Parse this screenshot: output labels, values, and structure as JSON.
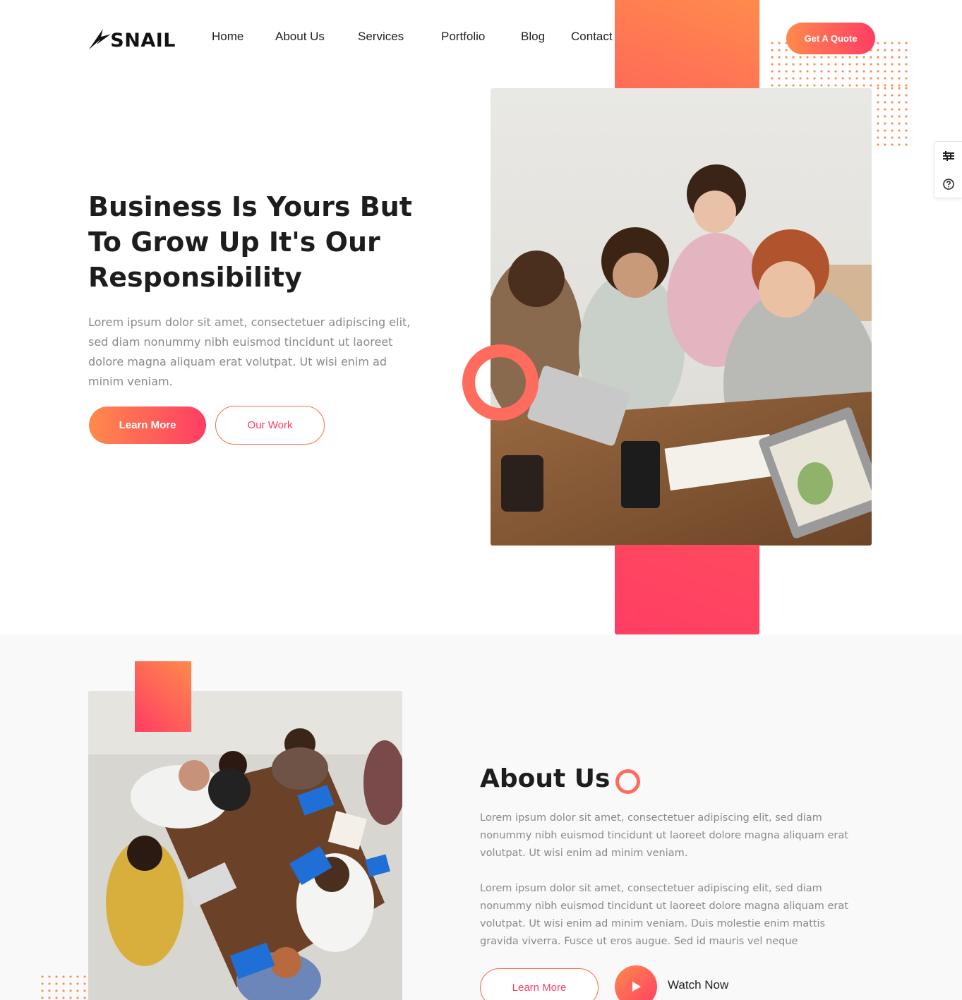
{
  "brand": {
    "name": "SNAIL"
  },
  "nav": {
    "items": [
      "Home",
      "About Us",
      "Services",
      "Portfolio",
      "Blog",
      "Contact"
    ]
  },
  "header": {
    "quote_label": "Get A Quote"
  },
  "hero": {
    "title": "Business Is Yours But To Grow Up It's Our Responsibility",
    "description": "Lorem ipsum dolor sit amet, consectetuer adipiscing elit, sed diam nonummy nibh euismod tincidunt ut laoreet dolore magna aliquam erat volutpat. Ut wisi enim ad minim veniam.",
    "primary_button": "Learn More",
    "secondary_button": "Our Work"
  },
  "side_tools": {
    "icons": [
      "sliders-icon",
      "help-icon"
    ]
  },
  "about": {
    "title": "About Us",
    "paragraph_1": "Lorem ipsum dolor sit amet, consectetuer adipiscing elit, sed diam nonummy nibh euismod tincidunt ut laoreet dolore magna aliquam erat volutpat. Ut wisi enim ad minim veniam.",
    "paragraph_2": "Lorem ipsum dolor sit amet, consectetuer adipiscing elit, sed diam nonummy nibh euismod tincidunt ut laoreet dolore magna aliquam erat volutpat. Ut wisi enim ad minim veniam. Duis molestie enim mattis gravida viverra. Fusce ut eros augue. Sed id mauris vel neque",
    "button": "Learn More",
    "watch_label": "Watch Now"
  },
  "colors": {
    "accent_orange": "#ff8a4c",
    "accent_pink": "#ff3d64",
    "text_dark": "#1d1d1d",
    "text_muted": "#8a8a8a",
    "section_bg": "#f9f9f9"
  }
}
